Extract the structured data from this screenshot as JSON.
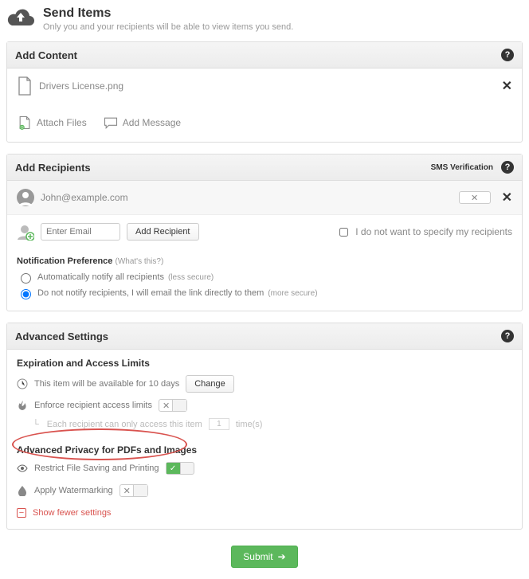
{
  "header": {
    "title": "Send Items",
    "subtitle": "Only you and your recipients will be able to view items you send."
  },
  "content": {
    "title": "Add Content",
    "files": [
      {
        "name": "Drivers License.png"
      }
    ],
    "attach_label": "Attach Files",
    "message_label": "Add Message"
  },
  "recipients": {
    "title": "Add Recipients",
    "sms_label": "SMS Verification",
    "list": [
      {
        "email": "John@example.com"
      }
    ],
    "email_placeholder": "Enter Email",
    "add_button": "Add Recipient",
    "nospecify_label": "I do not want to specify my recipients"
  },
  "notification": {
    "title": "Notification Preference",
    "whats_this": "(What's this?)",
    "option_auto": "Automatically notify all recipients",
    "auto_hint": "(less secure)",
    "option_manual": "Do not notify recipients, I will email the link directly to them",
    "manual_hint": "(more secure)",
    "selected": "manual"
  },
  "advanced": {
    "title": "Advanced Settings",
    "expiration_title": "Expiration and Access Limits",
    "available_text": "This item will be available for 10 days",
    "change_button": "Change",
    "enforce_label": "Enforce recipient access limits",
    "enforce_on": false,
    "access_line_pre": "Each recipient can only access this item",
    "access_value": "1",
    "access_line_post": "time(s)",
    "privacy_title": "Advanced Privacy for PDFs and Images",
    "restrict_label": "Restrict File Saving and Printing",
    "restrict_on": true,
    "watermark_label": "Apply Watermarking",
    "watermark_on": false,
    "show_fewer": "Show fewer settings"
  },
  "submit": {
    "label": "Submit"
  }
}
